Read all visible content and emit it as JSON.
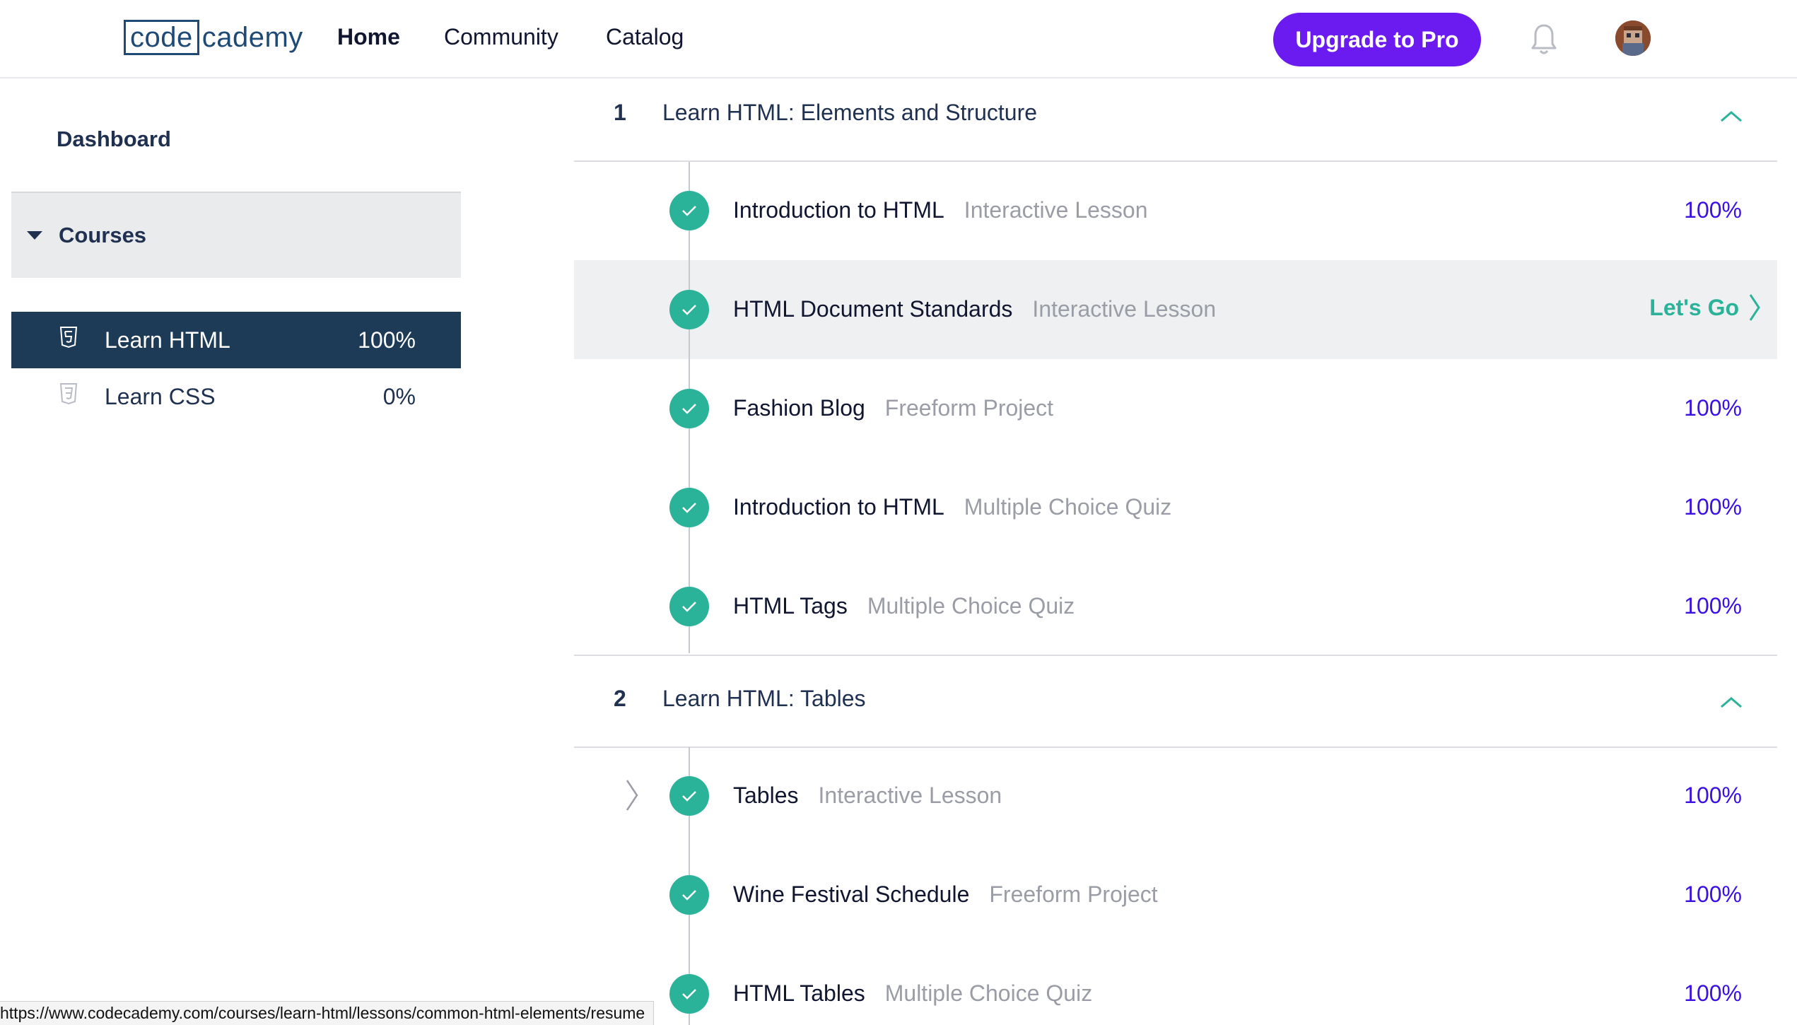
{
  "nav": {
    "logo_boxed": "code",
    "logo_rest": "cademy",
    "home": "Home",
    "community": "Community",
    "catalog": "Catalog",
    "upgrade": "Upgrade to Pro"
  },
  "sidebar": {
    "dashboard": "Dashboard",
    "courses_label": "Courses",
    "courses": [
      {
        "name": "Learn HTML",
        "percent": "100%",
        "active": true
      },
      {
        "name": "Learn CSS",
        "percent": "0%",
        "active": false
      }
    ]
  },
  "modules": [
    {
      "number": "1",
      "title": "Learn HTML: Elements and Structure",
      "lessons": [
        {
          "title": "Introduction to HTML",
          "type": "Interactive Lesson",
          "percent": "100%"
        },
        {
          "title": "HTML Document Standards",
          "type": "Interactive Lesson",
          "action": "Let's Go"
        },
        {
          "title": "Fashion Blog",
          "type": "Freeform Project",
          "percent": "100%"
        },
        {
          "title": "Introduction to HTML",
          "type": "Multiple Choice Quiz",
          "percent": "100%"
        },
        {
          "title": "HTML Tags",
          "type": "Multiple Choice Quiz",
          "percent": "100%"
        }
      ]
    },
    {
      "number": "2",
      "title": "Learn HTML: Tables",
      "lessons": [
        {
          "title": "Tables",
          "type": "Interactive Lesson",
          "percent": "100%"
        },
        {
          "title": "Wine Festival Schedule",
          "type": "Freeform Project",
          "percent": "100%"
        },
        {
          "title": "HTML Tables",
          "type": "Multiple Choice Quiz",
          "percent": "100%"
        }
      ]
    }
  ],
  "status_url": "https://www.codecademy.com/courses/learn-html/lessons/common-html-elements/resume",
  "colors": {
    "brand_purple": "#6b1bf0",
    "teal": "#2bb39a",
    "percent_blue": "#3a10e5",
    "navy": "#1d3b57"
  }
}
